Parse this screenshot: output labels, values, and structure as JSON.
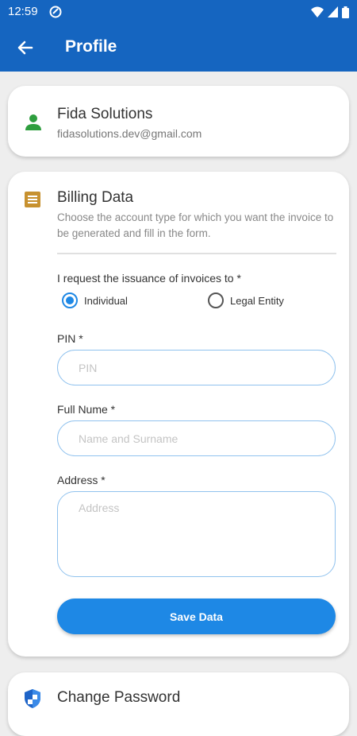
{
  "status_bar": {
    "time": "12:59",
    "icons": [
      "app-notification-icon",
      "wifi-icon",
      "signal-icon",
      "battery-icon"
    ]
  },
  "app_bar": {
    "title": "Profile",
    "back_icon": "arrow-back-icon",
    "color": "#1565c0"
  },
  "profile": {
    "name": "Fida Solutions",
    "email": "fidasolutions.dev@gmail.com",
    "icon": "person-icon",
    "icon_color": "#2e9e3e"
  },
  "billing": {
    "icon": "receipt-icon",
    "icon_color": "#c7912f",
    "title": "Billing Data",
    "description": "Choose the account type for which you want the invoice to be generated and fill in the form.",
    "request_label": "I request the issuance of invoices to *",
    "options": [
      {
        "label": "Individual",
        "selected": true
      },
      {
        "label": "Legal Entity",
        "selected": false
      }
    ],
    "fields": {
      "pin": {
        "label": "PIN *",
        "placeholder": "PIN",
        "value": ""
      },
      "full_name": {
        "label": "Full Nume *",
        "placeholder": "Name and Surname",
        "value": ""
      },
      "address": {
        "label": "Address *",
        "placeholder": "Address",
        "value": ""
      }
    },
    "save_label": "Save Data",
    "accent_color": "#1e88e5"
  },
  "password": {
    "icon": "shield-icon",
    "title": "Change Password"
  }
}
